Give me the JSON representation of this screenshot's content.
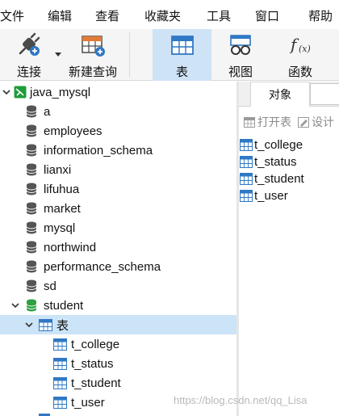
{
  "menu": [
    "文件",
    "编辑",
    "查看",
    "收藏夹",
    "工具",
    "窗口",
    "帮助"
  ],
  "toolbar": {
    "connect_label": "连接",
    "new_query_label": "新建查询",
    "table_label": "表",
    "view_label": "视图",
    "function_label": "函数"
  },
  "tree": {
    "connection": "java_mysql",
    "databases": [
      "a",
      "employees",
      "information_schema",
      "lianxi",
      "lifuhua",
      "market",
      "mysql",
      "northwind",
      "performance_schema",
      "sd",
      "student"
    ],
    "tables_folder": "表",
    "tables": [
      "t_college",
      "t_status",
      "t_student",
      "t_user"
    ]
  },
  "panel": {
    "tab_label": "对象",
    "open_table_label": "打开表",
    "design_label": "设计",
    "objects": [
      "t_college",
      "t_status",
      "t_student",
      "t_user"
    ]
  },
  "watermark": "https://blog.csdn.net/qq_Lisa",
  "colors": {
    "selection": "#cce4f7",
    "active_toolbar": "#cfe3f7",
    "database_icon": "#555555",
    "open_database_icon": "#2ea043",
    "connection_icon": "#1f9d3a",
    "table_icon": "#2f78c4"
  }
}
